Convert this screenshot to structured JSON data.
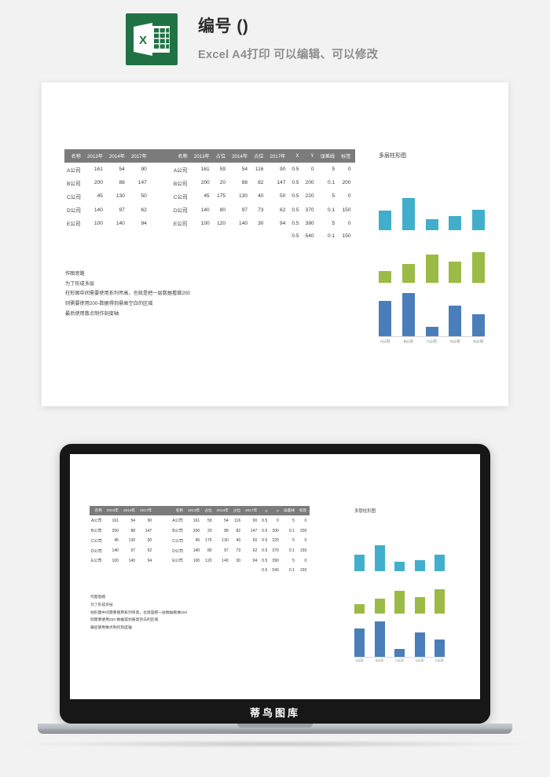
{
  "header": {
    "logo_icon": "excel-file-icon",
    "logo_letter": "X",
    "title": "编号 ()",
    "subtitle": "Excel A4打印 可以编辑、可以修改"
  },
  "colors": {
    "page_background": "#f2f2f2",
    "card_background": "#ffffff",
    "table_header_bg": "#7b7b7b",
    "table_header_text": "#ffffff",
    "excel_green": "#1f7244",
    "series_teal": "#41afcb",
    "series_green": "#9bbb46",
    "series_blue": "#4a7ebb",
    "axis_line": "#d6d6d6",
    "laptop_bezel": "#171717"
  },
  "worksheet": {
    "left_table": {
      "headers": [
        "名称",
        "2013年",
        "2014年",
        "2017年"
      ],
      "rows": [
        [
          "A公司",
          "161",
          "54",
          "90"
        ],
        [
          "B公司",
          "200",
          "88",
          "147"
        ],
        [
          "C公司",
          "45",
          "130",
          "50"
        ],
        [
          "D公司",
          "140",
          "97",
          "62"
        ],
        [
          "E公司",
          "100",
          "140",
          "94"
        ],
        [
          "",
          "",
          "",
          ""
        ]
      ]
    },
    "right_table": {
      "headers": [
        "名称",
        "2013年",
        "占位",
        "2014年",
        "占位",
        "2017年",
        "X",
        "Y",
        "误差线",
        "标签"
      ],
      "rows": [
        [
          "A公司",
          "161",
          "59",
          "54",
          "116",
          "90",
          "0.5",
          "0",
          "5",
          "0"
        ],
        [
          "B公司",
          "200",
          "20",
          "88",
          "82",
          "147",
          "0.5",
          "200",
          "0.1",
          "200"
        ],
        [
          "C公司",
          "45",
          "175",
          "130",
          "40",
          "50",
          "0.5",
          "220",
          "5",
          "0"
        ],
        [
          "D公司",
          "140",
          "80",
          "97",
          "73",
          "62",
          "0.5",
          "370",
          "0.1",
          "150"
        ],
        [
          "E公司",
          "100",
          "120",
          "140",
          "30",
          "94",
          "0.5",
          "390",
          "5",
          "0"
        ],
        [
          "",
          "",
          "",
          "",
          "",
          "",
          "0.5",
          "540",
          "0.1",
          "150"
        ]
      ]
    },
    "notes": {
      "heading": "作图思路",
      "lines": [
        "为了形成多层",
        "柱形图中间需要使用系列吊高，也就是把一层数据看做200",
        "则需要使用200-数据得到悬高空白的区域",
        "最后使用散点制作刻度轴"
      ]
    }
  },
  "chart_data": {
    "type": "bar",
    "title": "多层柱形图",
    "xlabel": "",
    "ylabel": "",
    "categories": [
      "A公司",
      "B公司",
      "C公司",
      "D公司",
      "E公司"
    ],
    "series": [
      {
        "name": "2017年",
        "color": "#41afcb",
        "values": [
          90,
          147,
          50,
          62,
          94
        ]
      },
      {
        "name": "2014年",
        "color": "#9bbb46",
        "values": [
          54,
          88,
          130,
          97,
          140
        ]
      },
      {
        "name": "2013年",
        "color": "#4a7ebb",
        "values": [
          161,
          200,
          45,
          140,
          100
        ]
      }
    ],
    "ylim": [
      0,
      200
    ],
    "grid": false,
    "legend": "none",
    "layers": 3
  },
  "laptop": {
    "watermark": "蒂鸟图库"
  }
}
